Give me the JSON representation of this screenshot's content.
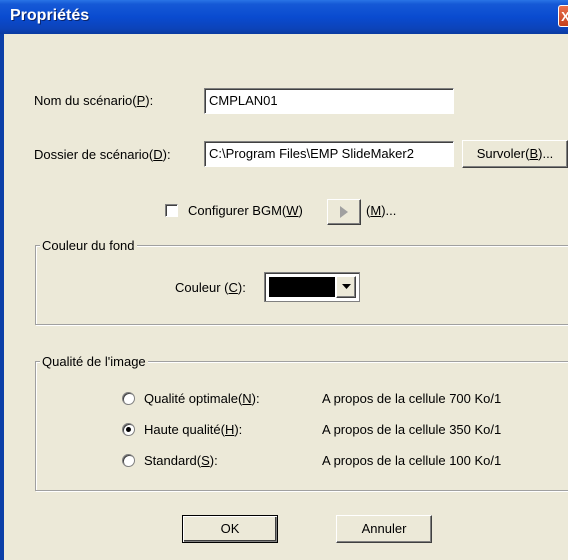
{
  "window": {
    "title": "Propriétés",
    "close_glyph": "X"
  },
  "scenario_name": {
    "label_pre": "Nom du scénario(",
    "label_key": "P",
    "label_post": "):",
    "value": "CMPLAN01"
  },
  "scenario_folder": {
    "label_pre": "Dossier de scénario(",
    "label_key": "D",
    "label_post": "):",
    "value": "C:\\Program Files\\EMP SlideMaker2",
    "browse_pre": "Survoler(",
    "browse_key": "B",
    "browse_post": ")..."
  },
  "bgm": {
    "checked": false,
    "label_pre": "Configurer BGM(",
    "label_key": "W",
    "label_post": ")",
    "play_icon": "play-icon",
    "m_pre": "(",
    "m_key": "M",
    "m_post": ")..."
  },
  "background": {
    "group_label": "Couleur du fond",
    "color_label_pre": "Couleur (",
    "color_label_key": "C",
    "color_label_post": "):",
    "selected_color": "#000000"
  },
  "image_quality": {
    "group_label": "Qualité de l'image",
    "options": [
      {
        "label_pre": "Qualité optimale(",
        "label_key": "N",
        "label_post": "):",
        "description": "A propos de la cellule 700 Ko/1",
        "selected": false
      },
      {
        "label_pre": "Haute qualité(",
        "label_key": "H",
        "label_post": "):",
        "description": "A propos de la cellule 350 Ko/1",
        "selected": true
      },
      {
        "label_pre": "Standard(",
        "label_key": "S",
        "label_post": "):",
        "description": "A propos de la cellule 100 Ko/1",
        "selected": false
      }
    ]
  },
  "buttons": {
    "ok": "OK",
    "cancel": "Annuler"
  }
}
